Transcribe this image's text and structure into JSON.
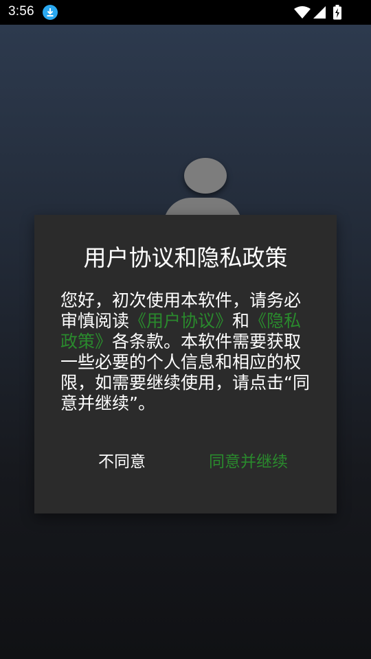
{
  "status_bar": {
    "time": "3:56",
    "icons": [
      "download-icon",
      "wifi-icon",
      "signal-icon",
      "battery-icon"
    ]
  },
  "background_icons": [
    "user-avatar-icon"
  ],
  "dialog": {
    "title": "用户协议和隐私政策",
    "message": {
      "part1": "您好，初次使用本软件，请务必审慎阅读",
      "user_agreement_link": "《用户协议》",
      "part2": "和",
      "privacy_policy_link": "《隐私政策》",
      "part3": "各条款。本软件需要获取一些必要的个人信息和相应的权限，如需要继续使用，请点击“同意并继续”。"
    },
    "disagree_label": "不同意",
    "agree_label": "同意并继续"
  },
  "colors": {
    "link": "#2a8a2d",
    "dialog_bg": "#2b2b2b",
    "accent_blue": "#2aa8f0"
  }
}
